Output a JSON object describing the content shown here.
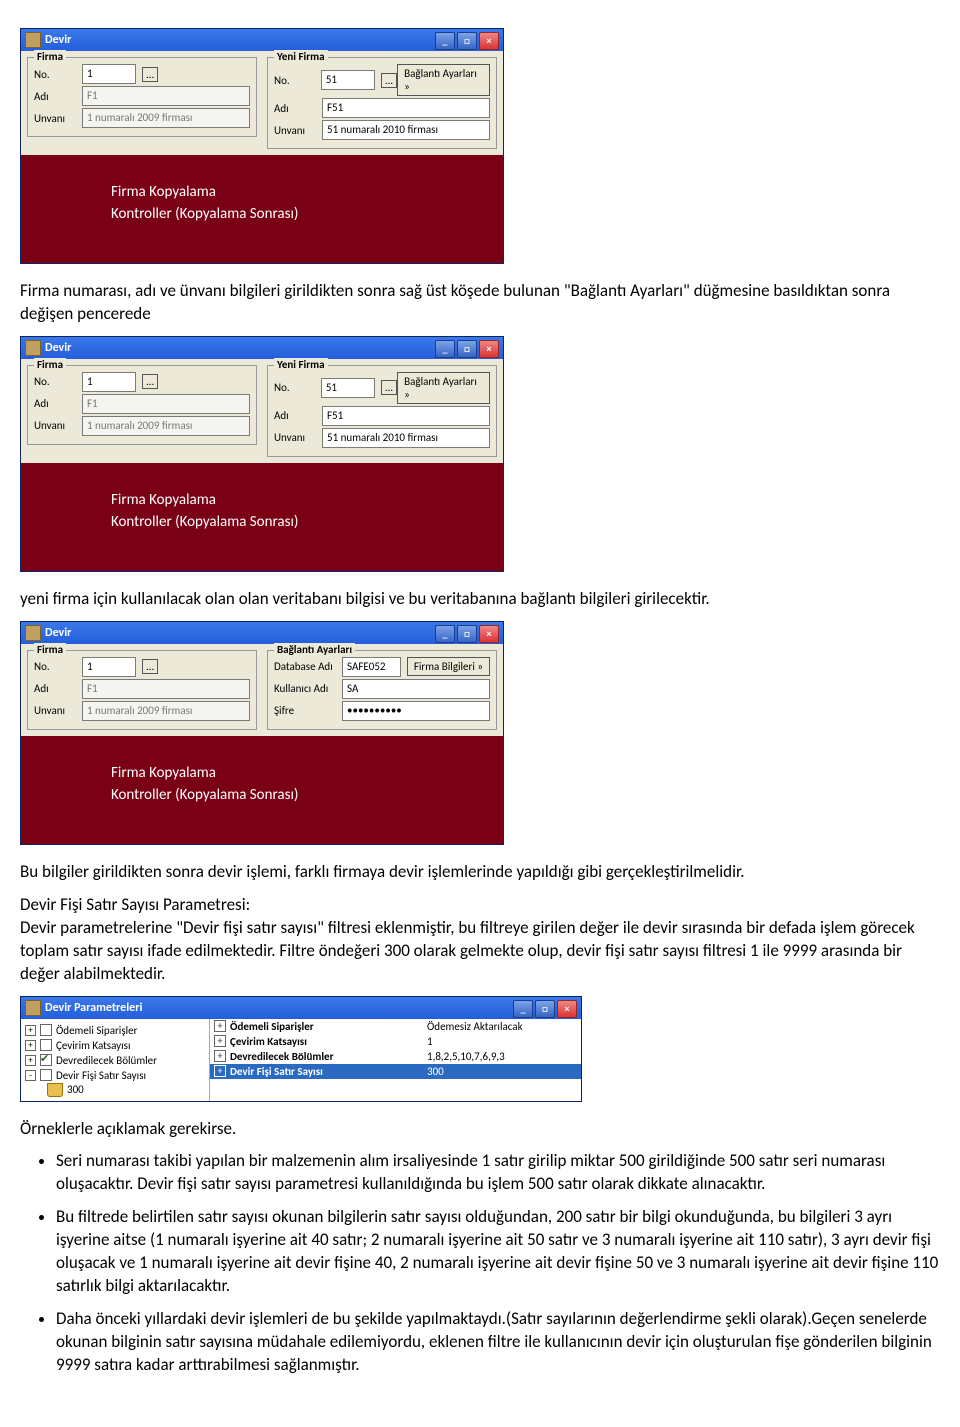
{
  "win_title": "Devir",
  "win_min": "_",
  "win_max": "□",
  "win_close": "×",
  "firma": {
    "legend": "Firma",
    "no_label": "No.",
    "no_value": "1",
    "adi_label": "Adı",
    "adi_value": "F1",
    "unvani_label": "Unvanı",
    "unvani_value": "1 numaralı 2009 firması"
  },
  "yeni_firma": {
    "legend": "Yeni Firma",
    "no_label": "No.",
    "no_value": "51",
    "btn_ayarlari": "Bağlantı Ayarları »",
    "adi_label": "Adı",
    "adi_value": "F51",
    "unvani_label": "Unvanı",
    "unvani_value": "51 numaralı 2010 firması"
  },
  "maroon1": "Firma Kopyalama",
  "maroon2": "Kontroller (Kopyalama Sonrası)",
  "para1": "Firma numarası, adı ve ünvanı bilgileri girildikten sonra sağ üst köşede bulunan \"Bağlantı Ayarları\" düğmesine basıldıktan sonra değişen pencerede",
  "para2": "yeni firma için kullanılacak olan olan veritabanı bilgisi ve bu veritabanına bağlantı bilgileri girilecektir.",
  "baglanti": {
    "legend": "Bağlantı Ayarları",
    "db_label": "Database Adı",
    "db_value": "SAFE052",
    "kul_label": "Kullanıcı Adı",
    "kul_value": "SA",
    "sifre_label": "Şifre",
    "sifre_value": "••••••••••",
    "btn_firma": "Firma Bilgileri »"
  },
  "para3": "Bu bilgiler girildikten sonra devir işlemi, farklı firmaya devir işlemlerinde yapıldığı gibi gerçekleştirilmelidir.",
  "para4a": "Devir Fişi Satır Sayısı Parametresi:",
  "para4b": "Devir parametrelerine \"Devir fişi satır sayısı\" filtresi eklenmiştir, bu filtreye girilen değer ile devir sırasında bir defada işlem görecek toplam satır sayısı ifade edilmektedir. Filtre öndeğeri 300 olarak gelmekte olup, devir fişi satır sayısı filtresi 1 ile 9999 arasında bir değer alabilmektedir.",
  "param_title": "Devir Parametreleri",
  "ptree": {
    "i1": "Ödemeli Siparişler",
    "i2": "Çevirim Katsayısı",
    "i3": "Devredilecek Bölümler",
    "i4": "Devir Fişi Satır Sayısı",
    "i5": "300"
  },
  "plist": {
    "r1l": "Ödemeli Siparişler",
    "r1v": "Ödemesiz Aktarılacak",
    "r2l": "Çevirim Katsayısı",
    "r2v": "1",
    "r3l": "Devredilecek Bölümler",
    "r3v": "1,8,2,5,10,7,6,9,3",
    "r4l": "Devir Fişi Satır Sayısı",
    "r4v": "300"
  },
  "ornek_head": "Örneklerle açıklamak gerekirse.",
  "bul1": "Seri numarası takibi yapılan bir malzemenin alım irsaliyesinde 1 satır girilip miktar 500 girildiğinde 500 satır seri numarası oluşacaktır. Devir fişi satır sayısı parametresi kullanıldığında bu işlem 500 satır olarak dikkate alınacaktır.",
  "bul2": "Bu filtrede belirtilen satır sayısı okunan bilgilerin satır sayısı olduğundan, 200 satır bir bilgi okunduğunda, bu bilgileri 3 ayrı işyerine aitse (1 numaralı işyerine ait 40 satır; 2 numaralı işyerine ait 50 satır ve 3 numaralı işyerine ait 110 satır), 3 ayrı devir fişi oluşacak ve 1 numaralı işyerine ait devir fişine 40, 2 numaralı işyerine ait devir fişine 50 ve 3 numaralı işyerine ait devir fişine 110 satırlık bilgi aktarılacaktır.",
  "bul3": "Daha önceki yıllardaki devir işlemleri de bu şekilde yapılmaktaydı.(Satır sayılarının değerlendirme şekli olarak).Geçen senelerde okunan bilginin satır sayısına müdahale edilemiyordu, eklenen filtre ile kullanıcının devir için oluşturulan fişe gönderilen bilginin 9999 satıra kadar arttırabilmesi sağlanmıştır."
}
